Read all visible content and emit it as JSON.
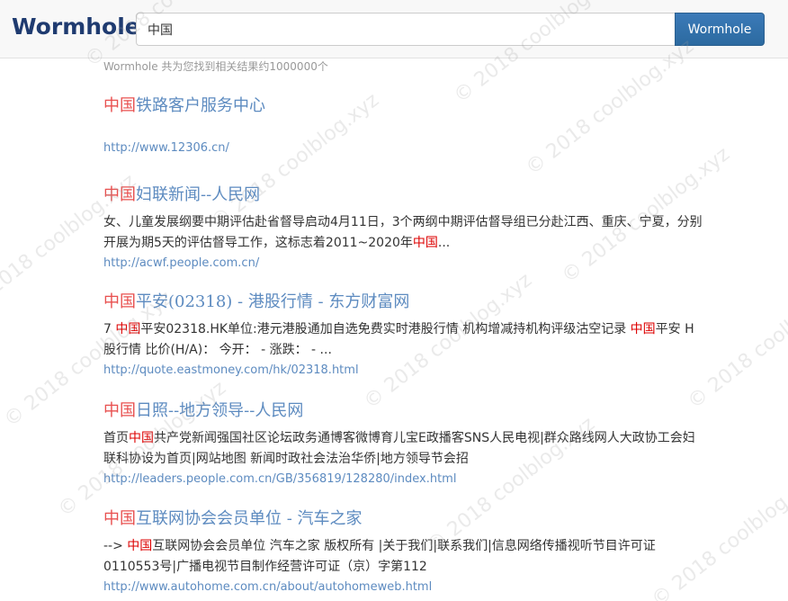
{
  "header": {
    "logo": "Wormhole",
    "search_value": "中国",
    "search_button": "Wormhole"
  },
  "stats": "Wormhole 共为您找到相关结果约1000000个",
  "results": [
    {
      "title_hl": "中国",
      "title_rest": "铁路客户服务中心",
      "desc": [],
      "url": "http://www.12306.cn/"
    },
    {
      "title_hl": "中国",
      "title_rest": "妇联新闻--人民网",
      "desc": [
        {
          "t": "女、儿童发展纲要中期评估赴省督导启动4月11日，3个两纲中期评估督导组已分赴江西、重庆、宁夏，分别开展为期5天的评估督导工作，这标志着2011~2020年",
          "hl": false
        },
        {
          "t": "中国",
          "hl": true
        },
        {
          "t": "...",
          "hl": false
        }
      ],
      "url": "http://acwf.people.com.cn/"
    },
    {
      "title_hl": "中国",
      "title_rest": "平安(02318) - 港股行情 - 东方财富网",
      "desc": [
        {
          "t": "7 ",
          "hl": false
        },
        {
          "t": "中国",
          "hl": true
        },
        {
          "t": "平安02318.HK单位:港元港股通加自选免费实时港股行情 机构增减持机构评级沽空记录 ",
          "hl": false
        },
        {
          "t": "中国",
          "hl": true
        },
        {
          "t": "平安 H股行情 比价(H/A)：  今开：  - 涨跌：  - ...",
          "hl": false
        }
      ],
      "url": "http://quote.eastmoney.com/hk/02318.html"
    },
    {
      "title_hl": "中国",
      "title_rest": "日照--地方领导--人民网",
      "desc": [
        {
          "t": "首页",
          "hl": false
        },
        {
          "t": "中国",
          "hl": true
        },
        {
          "t": "共产党新闻强国社区论坛政务通博客微博育儿宝E政播客SNS人民电视|群众路线网人大政协工会妇联科协设为首页|网站地图 新闻时政社会法治华侨|地方领导节会招",
          "hl": false
        }
      ],
      "url": "http://leaders.people.com.cn/GB/356819/128280/index.html"
    },
    {
      "title_hl": "中国",
      "title_rest": "互联网协会会员单位 - 汽车之家",
      "desc": [
        {
          "t": "--> ",
          "hl": false
        },
        {
          "t": "中国",
          "hl": true
        },
        {
          "t": "互联网协会会员单位 汽车之家 版权所有 |关于我们|联系我们|信息网络传播视听节目许可证0110553号|广播电视节目制作经营许可证（京）字第112",
          "hl": false
        }
      ],
      "url": "http://www.autohome.com.cn/about/autohomeweb.html"
    }
  ],
  "watermark": "© 2018 coolblog.xyz",
  "colors": {
    "logo": "#1f3b70",
    "link": "#5d8bc0",
    "highlight": "#dd0000",
    "button": "#2c6aa0"
  }
}
